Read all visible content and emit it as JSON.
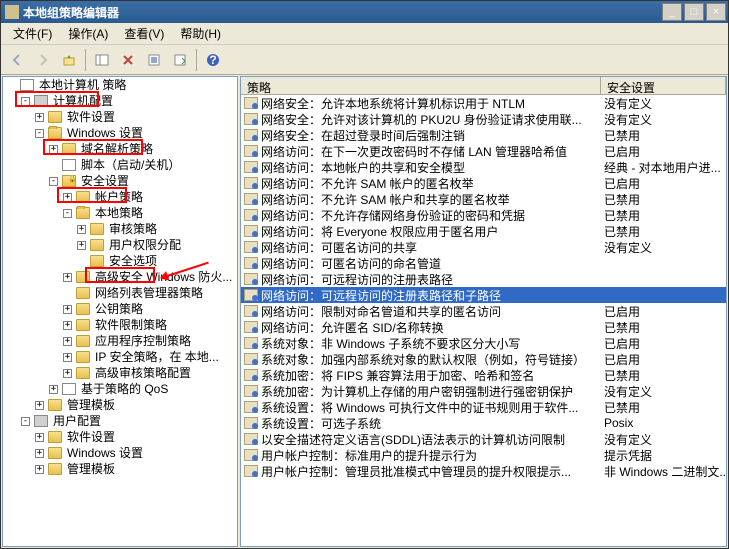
{
  "window": {
    "title": "本地组策略编辑器"
  },
  "menu": {
    "file": "文件(F)",
    "action": "操作(A)",
    "view": "查看(V)",
    "help": "帮助(H)"
  },
  "toolbar": {
    "back": "back",
    "forward": "forward",
    "up": "up",
    "show": "show",
    "xsel": "xsel",
    "refresh": "refresh",
    "export": "export",
    "help": "help"
  },
  "tree": {
    "root": "本地计算机 策略",
    "computer_config": "计算机配置",
    "software_settings1": "软件设置",
    "windows_settings": "Windows 设置",
    "name_resolution": "域名解析策略",
    "scripts": "脚本（启动/关机）",
    "security_settings": "安全设置",
    "account_policies": "帐户策略",
    "local_policies": "本地策略",
    "audit_policy": "审核策略",
    "user_rights": "用户权限分配",
    "security_options": "安全选项",
    "adv_firewall": "高级安全 Windows 防火...",
    "network_list": "网络列表管理器策略",
    "public_key": "公钥策略",
    "software_restrict": "软件限制策略",
    "app_control": "应用程序控制策略",
    "ip_security": "IP 安全策略，在 本地...",
    "adv_audit": "高级审核策略配置",
    "qos": "基于策略的 QoS",
    "admin_templates1": "管理模板",
    "user_config": "用户配置",
    "software_settings2": "软件设置",
    "windows_settings2": "Windows 设置",
    "admin_templates2": "管理模板"
  },
  "columns": {
    "policy": "策略",
    "setting": "安全设置"
  },
  "rows": [
    {
      "p": "网络安全：允许本地系统将计算机标识用于 NTLM",
      "s": "没有定义"
    },
    {
      "p": "网络安全：允许对该计算机的 PKU2U 身份验证请求使用联...",
      "s": "没有定义"
    },
    {
      "p": "网络安全：在超过登录时间后强制注销",
      "s": "已禁用"
    },
    {
      "p": "网络访问：在下一次更改密码时不存储 LAN 管理器哈希值",
      "s": "已启用"
    },
    {
      "p": "网络访问：本地帐户的共享和安全模型",
      "s": "经典 - 对本地用户进..."
    },
    {
      "p": "网络访问：不允许 SAM 帐户的匿名枚举",
      "s": "已启用"
    },
    {
      "p": "网络访问：不允许 SAM 帐户和共享的匿名枚举",
      "s": "已禁用"
    },
    {
      "p": "网络访问：不允许存储网络身份验证的密码和凭据",
      "s": "已禁用"
    },
    {
      "p": "网络访问：将 Everyone 权限应用于匿名用户",
      "s": "已禁用"
    },
    {
      "p": "网络访问：可匿名访问的共享",
      "s": "没有定义"
    },
    {
      "p": "网络访问：可匿名访问的命名管道",
      "s": ""
    },
    {
      "p": "网络访问：可远程访问的注册表路径",
      "s": ""
    },
    {
      "p": "网络访问：可远程访问的注册表路径和子路径",
      "s": "",
      "selected": true
    },
    {
      "p": "网络访问：限制对命名管道和共享的匿名访问",
      "s": "已启用"
    },
    {
      "p": "网络访问：允许匿名 SID/名称转换",
      "s": "已禁用"
    },
    {
      "p": "系统对象：非 Windows 子系统不要求区分大小写",
      "s": "已启用"
    },
    {
      "p": "系统对象：加强内部系统对象的默认权限（例如，符号链接）",
      "s": "已启用"
    },
    {
      "p": "系统加密：将 FIPS 兼容算法用于加密、哈希和签名",
      "s": "已禁用"
    },
    {
      "p": "系统加密：为计算机上存储的用户密钥强制进行强密钥保护",
      "s": "没有定义"
    },
    {
      "p": "系统设置：将 Windows 可执行文件中的证书规则用于软件...",
      "s": "已禁用"
    },
    {
      "p": "系统设置：可选子系统",
      "s": "Posix"
    },
    {
      "p": "以安全描述符定义语言(SDDL)语法表示的计算机访问限制",
      "s": "没有定义"
    },
    {
      "p": "用户帐户控制：标准用户的提升提示行为",
      "s": "提示凭据"
    },
    {
      "p": "用户帐户控制：管理员批准模式中管理员的提升权限提示...",
      "s": "非 Windows 二进制文..."
    }
  ]
}
